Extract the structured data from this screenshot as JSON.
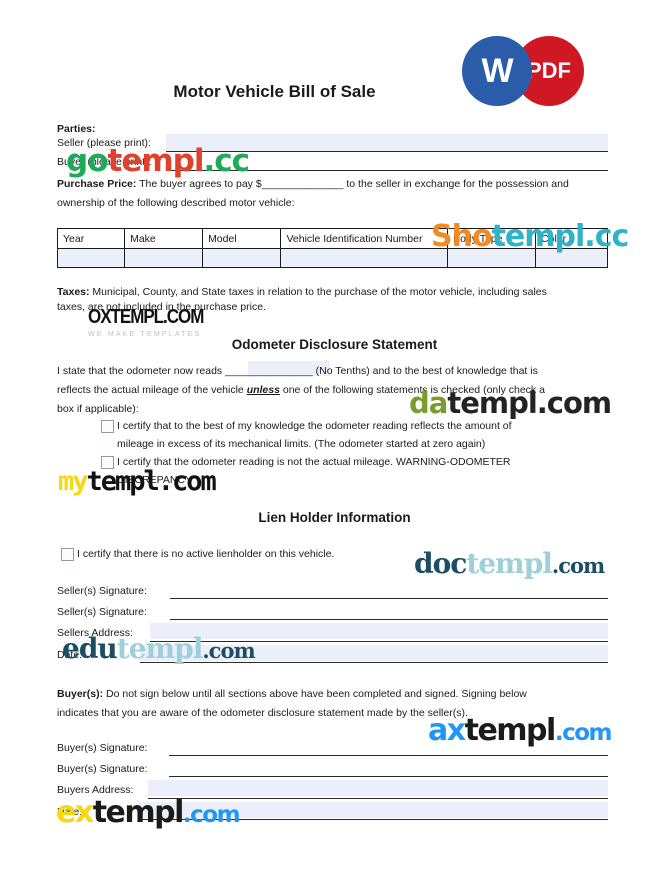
{
  "header": {
    "badge_word": "W",
    "badge_pdf": "PDF",
    "title": "Motor Vehicle Bill of Sale",
    "color_word_badge": "#2a5caa",
    "color_pdf_badge": "#d01824"
  },
  "parties": {
    "heading": "Parties:",
    "seller_label": "Seller (please print):",
    "buyer_label": "Buyer (please print):",
    "purchase_price_bold": "Purchase Price:",
    "purchase_price_text_1": " The buyer agrees to pay $",
    "purchase_price_blank": "______________",
    "purchase_price_text_2": " to the seller in exchange for the possession and",
    "purchase_price_line2": "ownership of the following described motor vehicle:"
  },
  "vehicle_table": {
    "columns": [
      "Year",
      "Make",
      "Model",
      "Vehicle Identification Number",
      "Body Type",
      "Color"
    ],
    "rows": [
      [
        "",
        "",
        "",
        "",
        "",
        ""
      ]
    ]
  },
  "taxes": {
    "bold": "Taxes:",
    "line1": " Municipal, County, and State taxes in relation to the purchase of the motor vehicle, including sales",
    "line2": "taxes, are not included in the purchase price."
  },
  "odometer": {
    "heading": "Odometer Disclosure Statement",
    "line1_a": "I state that the odometer now reads ",
    "line1_blank": "_______________",
    "line1_b": " (No Tenths) and to the best of knowledge that is",
    "line2_a": "reflects the actual mileage of the vehicle ",
    "line2_em": "unless",
    "line2_b": " one of the following statements is checked (only check a",
    "line3": "box if applicable):",
    "checkboxes": [
      {
        "line1": "I certify that to the best of my knowledge the odometer reading reflects the amount of",
        "line2": "mileage in excess of its mechanical limits. (The odometer started at zero again)"
      },
      {
        "line1": "I certify that the odometer reading is not the actual mileage. WARNING-ODOMETER",
        "line2": "DISCREPANCY"
      }
    ]
  },
  "lien": {
    "heading": "Lien Holder Information",
    "checkbox_label": "I certify that there is no active lienholder on this vehicle."
  },
  "seller_block": {
    "fields": [
      "Seller(s) Signature:",
      "Seller(s) Signature:",
      "Sellers Address:",
      "Date:"
    ]
  },
  "buyer_notice": {
    "bold": "Buyer(s):",
    "line1": " Do not sign below until all sections above have been completed and signed. Signing below",
    "line2": "indicates that you are aware of the odometer disclosure statement made by the seller(s)."
  },
  "buyer_block": {
    "fields": [
      "Buyer(s) Signature:",
      "Buyer(s) Signature:",
      "Buyers Address:",
      "Date:"
    ]
  },
  "watermarks": {
    "gotempl": {
      "a": "go",
      "b": "templ",
      "c": ".cc"
    },
    "shotempl": {
      "a": "Sho",
      "b": "templ",
      "c": ".cc"
    },
    "oxtempl": {
      "main": "OXTEMPL.COM",
      "sub": "WE MAKE TEMPLATES"
    },
    "datempl": {
      "a": "da",
      "b": "templ.com"
    },
    "mytempl": {
      "a": "my",
      "b": "templ.com"
    },
    "doctempl": {
      "a": "doc",
      "b": "templ",
      "c": ".com"
    },
    "edutempl": {
      "a": "edu",
      "b": "templ",
      "c": ".com"
    },
    "axtempl": {
      "a": "ax",
      "b": "templ",
      "c": ".com"
    },
    "extempl": {
      "a": "ex",
      "b": "templ",
      "c": ".com"
    }
  }
}
